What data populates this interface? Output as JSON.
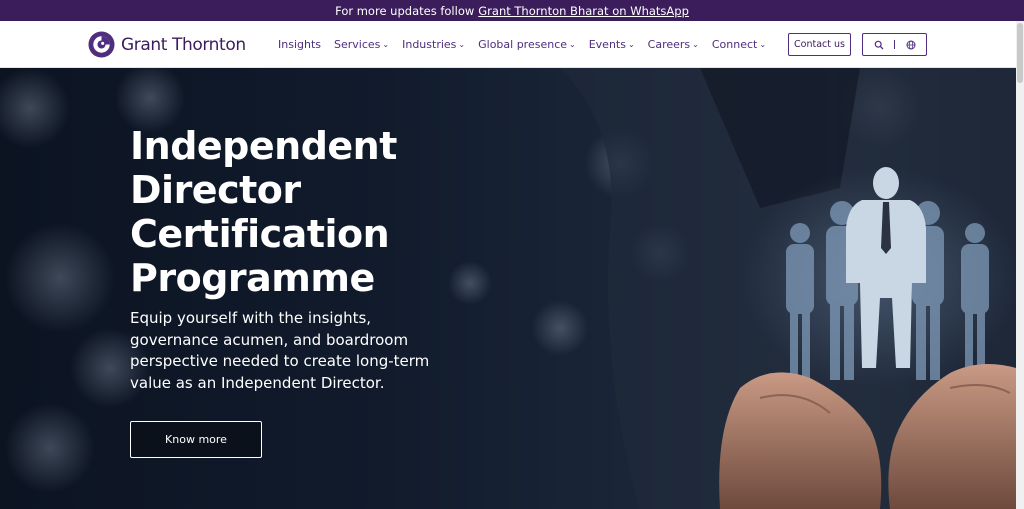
{
  "topbar": {
    "text": "For more updates follow",
    "link": "Grant Thornton Bharat on WhatsApp"
  },
  "brand": {
    "name": "Grant Thornton",
    "logo_icon": "grant-thornton-logo-icon"
  },
  "nav": {
    "items": [
      {
        "label": "Insights",
        "has_dropdown": false
      },
      {
        "label": "Services",
        "has_dropdown": true
      },
      {
        "label": "Industries",
        "has_dropdown": true
      },
      {
        "label": "Global presence",
        "has_dropdown": true
      },
      {
        "label": "Events",
        "has_dropdown": true
      },
      {
        "label": "Careers",
        "has_dropdown": true
      },
      {
        "label": "Connect",
        "has_dropdown": true
      }
    ],
    "dropdown_icon": "chevron-down-icon"
  },
  "header": {
    "contact_label": "Contact us",
    "search_icon": "search-icon",
    "language_icon": "globe-icon"
  },
  "hero": {
    "title_lines": [
      "Independent",
      "Director",
      "Certification",
      "Programme"
    ],
    "subtitle_lines": [
      "Equip yourself with the insights,",
      "governance acumen, and boardroom",
      "perspective needed to create long-term",
      "value as an Independent Director."
    ],
    "cta_label": "Know more"
  },
  "colors": {
    "brand_purple": "#4f2d7f",
    "topbar_bg": "#3b1d5c",
    "hero_bg": "#0c1422",
    "text_light": "#ffffff"
  }
}
